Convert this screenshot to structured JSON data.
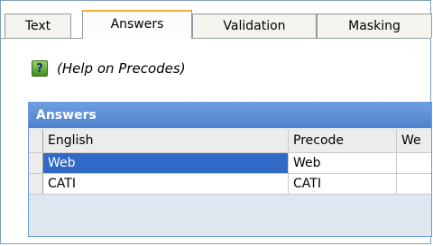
{
  "tabs": [
    {
      "label": "Text",
      "active": false
    },
    {
      "label": "Answers",
      "active": true
    },
    {
      "label": "Validation",
      "active": false
    },
    {
      "label": "Masking",
      "active": false
    }
  ],
  "help": {
    "icon": "help-question-icon",
    "label": "(Help on Precodes)"
  },
  "panel": {
    "title": "Answers"
  },
  "grid": {
    "columns": [
      "English",
      "Precode",
      "We"
    ],
    "rows": [
      {
        "english": "Web",
        "precode": "Web",
        "selected": true
      },
      {
        "english": "CATI",
        "precode": "CATI",
        "selected": false
      }
    ]
  },
  "colors": {
    "accent_tab": "#f7ad3c",
    "panel_header": "#5b8dd6",
    "selection": "#3169c6"
  }
}
